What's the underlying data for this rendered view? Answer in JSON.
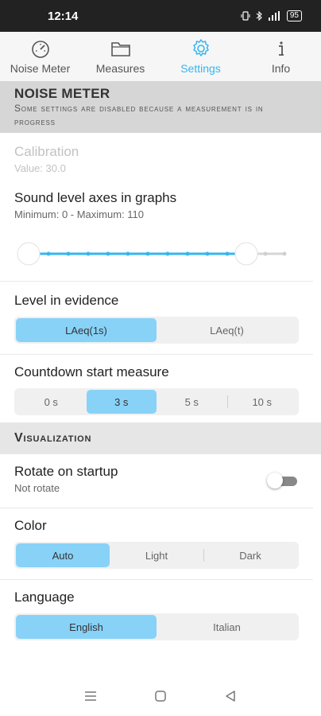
{
  "statusbar": {
    "time": "12:14",
    "battery": "95"
  },
  "tabs": [
    {
      "label": "Noise Meter",
      "icon": "gauge-icon"
    },
    {
      "label": "Measures",
      "icon": "folder-icon"
    },
    {
      "label": "Settings",
      "icon": "gear-icon",
      "active": true
    },
    {
      "label": "Info",
      "icon": "info-icon"
    }
  ],
  "noise_meter": {
    "header": "NOISE METER",
    "note": "Some settings are disabled because a measurement is in progress"
  },
  "calibration": {
    "title": "Calibration",
    "value": "Value: 30.0"
  },
  "axes": {
    "title": "Sound level axes in graphs",
    "range": "Minimum: 0 - Maximum: 110",
    "min": 0,
    "max": 110
  },
  "evidence": {
    "title": "Level in evidence",
    "options": [
      "LAeq(1s)",
      "LAeq(t)"
    ],
    "selected": "LAeq(1s)"
  },
  "countdown": {
    "title": "Countdown start measure",
    "options": [
      "0 s",
      "3 s",
      "5 s",
      "10 s"
    ],
    "selected": "3 s"
  },
  "visualization": {
    "header": "Visualization",
    "rotate": {
      "title": "Rotate on startup",
      "value": "Not rotate",
      "enabled": false
    },
    "color": {
      "title": "Color",
      "options": [
        "Auto",
        "Light",
        "Dark"
      ],
      "selected": "Auto"
    },
    "language": {
      "title": "Language",
      "options": [
        "English",
        "Italian"
      ],
      "selected": "English"
    }
  },
  "colors": {
    "accent": "#35b6ef",
    "selected_segment": "#88d2f8"
  }
}
